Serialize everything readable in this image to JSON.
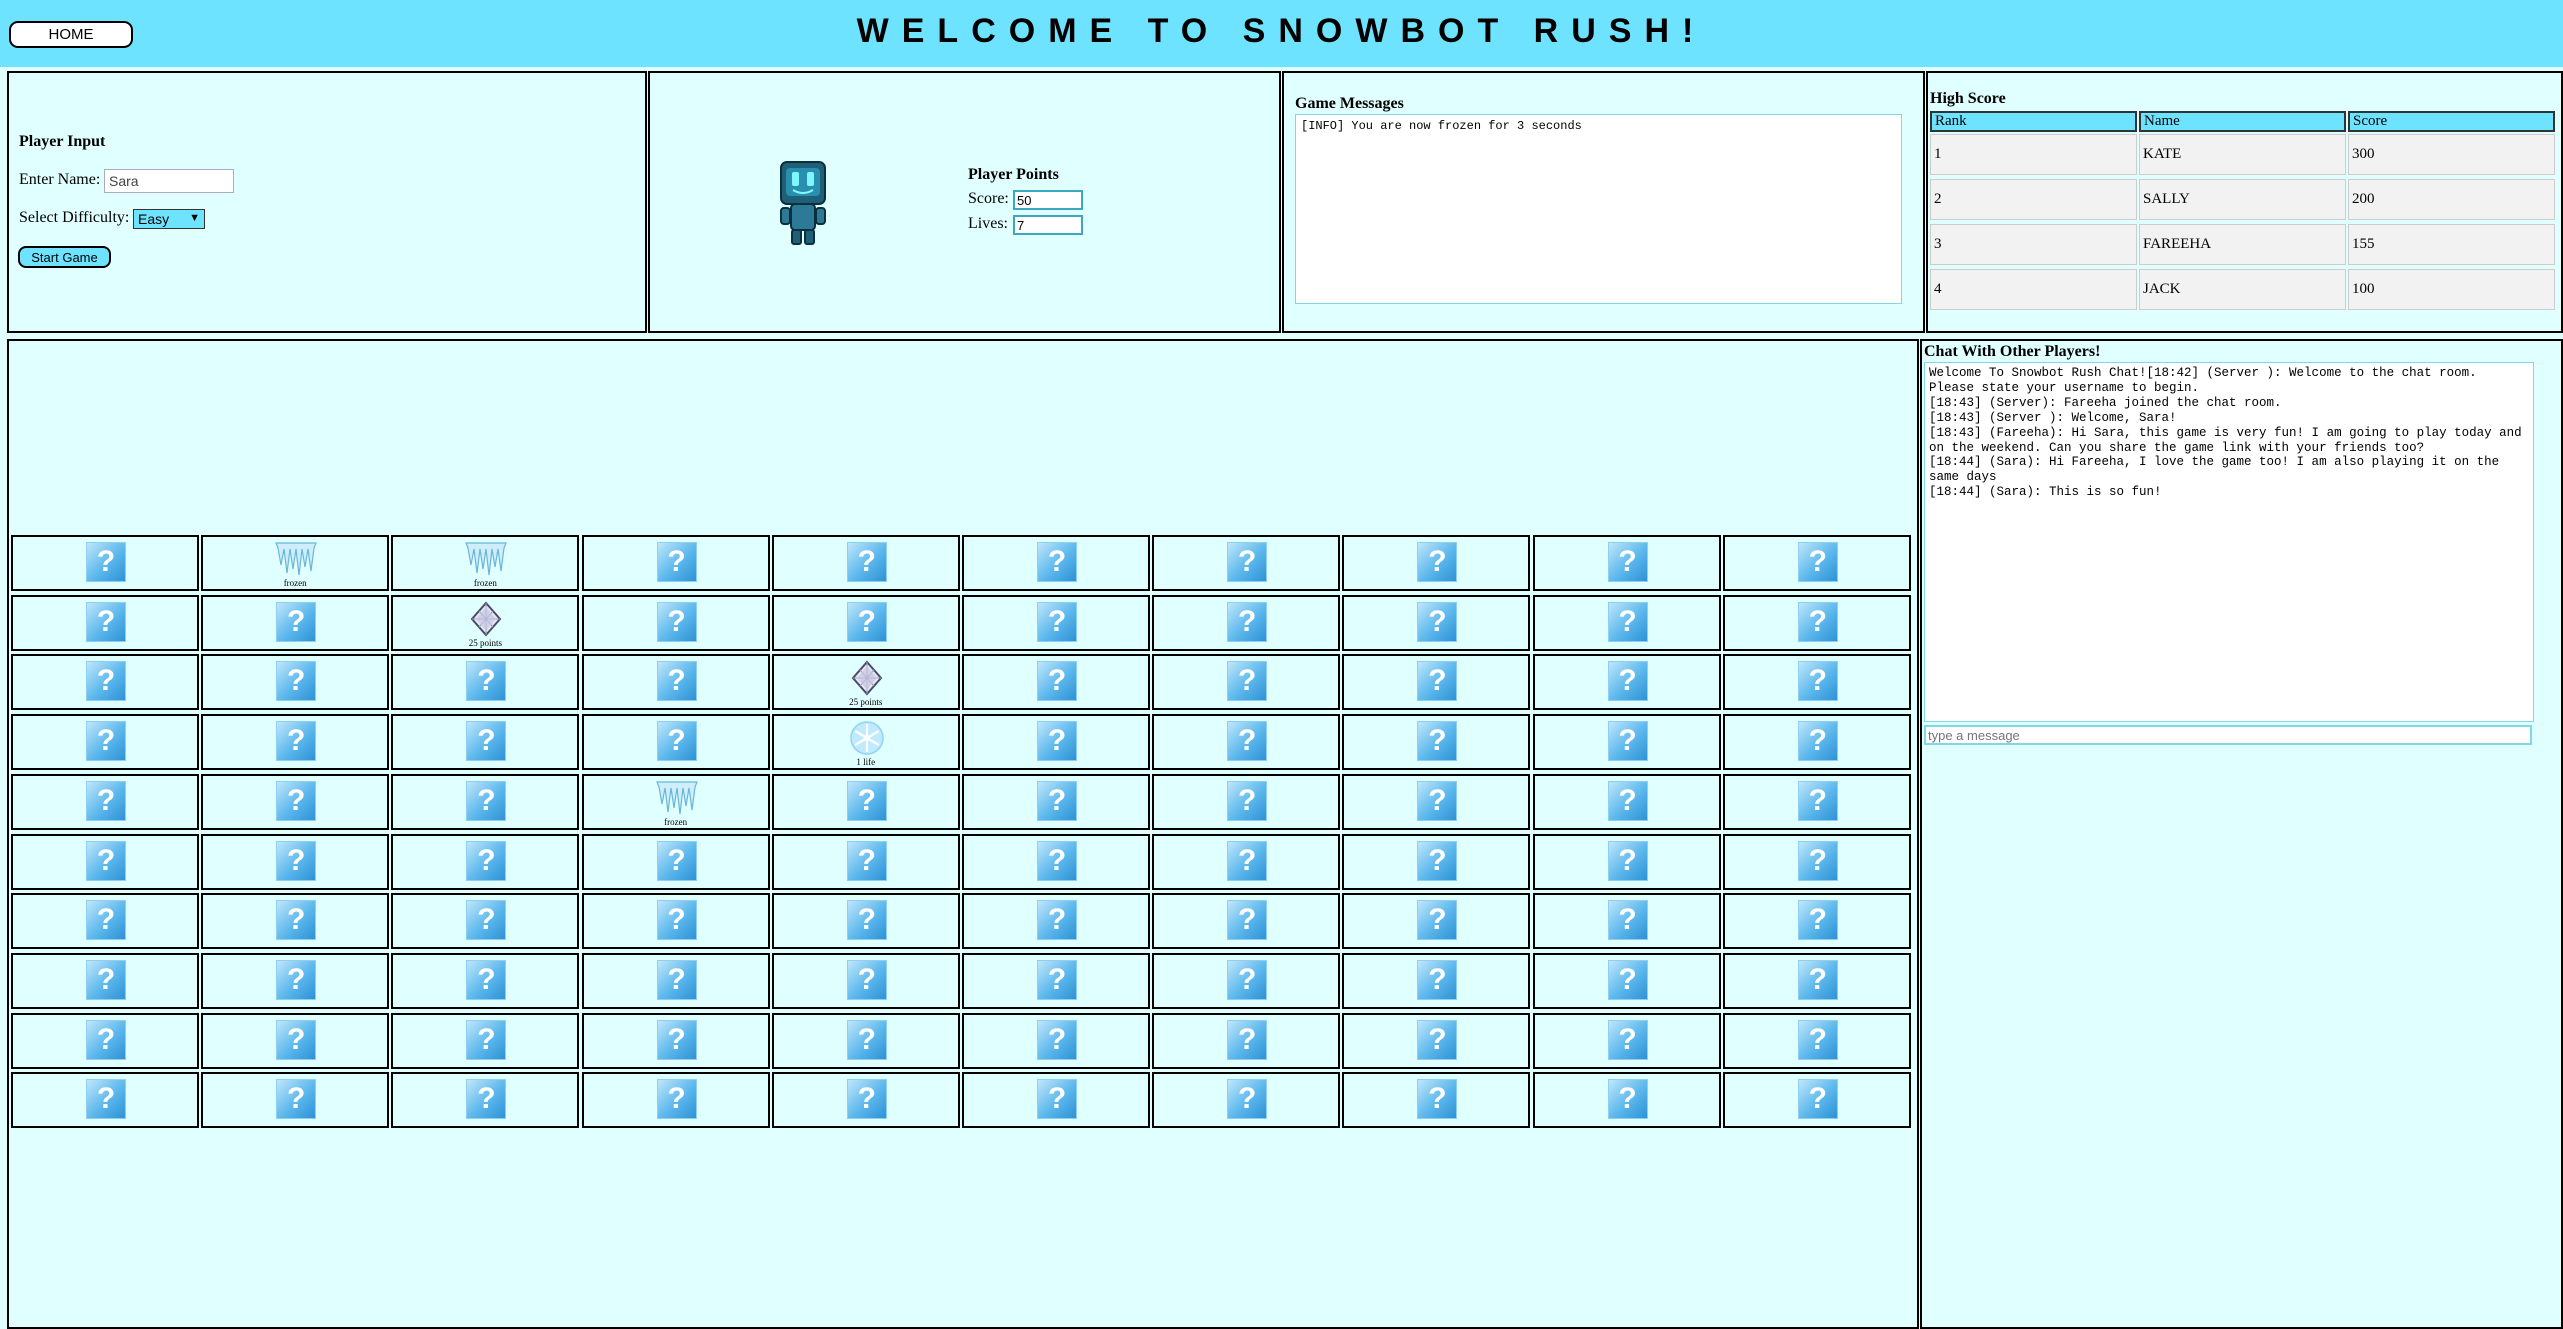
{
  "header": {
    "home_label": "HOME",
    "title": "WELCOME TO SNOWBOT RUSH!"
  },
  "player_input": {
    "title": "Player Input",
    "name_label": "Enter Name:",
    "name_value": "Sara",
    "difficulty_label": "Select Difficulty:",
    "difficulty_value": "Easy",
    "start_label": "Start Game"
  },
  "player_points": {
    "title": "Player Points",
    "score_label": "Score:",
    "score_value": "50",
    "lives_label": "Lives:",
    "lives_value": "7"
  },
  "game_messages": {
    "title": "Game Messages",
    "text": "[INFO] You are now frozen for 3 seconds"
  },
  "high_score": {
    "title": "High Score",
    "headers": [
      "Rank",
      "Name",
      "Score"
    ],
    "rows": [
      [
        "1",
        "KATE",
        "300"
      ],
      [
        "2",
        "SALLY",
        "200"
      ],
      [
        "3",
        "FAREEHA",
        "155"
      ],
      [
        "4",
        "JACK",
        "100"
      ]
    ]
  },
  "grid": {
    "rows": 10,
    "cols": 10,
    "hidden_symbol": "?",
    "revealed": [
      {
        "row": 0,
        "col": 1,
        "icon": "icicle-icon",
        "label": "frozen"
      },
      {
        "row": 0,
        "col": 2,
        "icon": "icicle-icon",
        "label": "frozen"
      },
      {
        "row": 1,
        "col": 2,
        "icon": "diamond-icon",
        "label": "25 points"
      },
      {
        "row": 2,
        "col": 4,
        "icon": "diamond-icon",
        "label": "25 points"
      },
      {
        "row": 3,
        "col": 4,
        "icon": "snowflake-icon",
        "label": "1 life"
      },
      {
        "row": 4,
        "col": 3,
        "icon": "icicle-icon",
        "label": "frozen"
      }
    ]
  },
  "chat": {
    "title": "Chat With Other Players!",
    "log": "Welcome To Snowbot Rush Chat![18:42] (Server ): Welcome to the chat room. Please state your username to begin.\n[18:43] (Server): Fareeha joined the chat room.\n[18:43] (Server ): Welcome, Sara!\n[18:43] (Fareeha): Hi Sara, this game is very fun! I am going to play today and on the weekend. Can you share the game link with your friends too?\n[18:44] (Sara): Hi Fareeha, I love the game too! I am also playing it on the same days\n[18:44] (Sara): This is so fun!",
    "placeholder": "type a message"
  },
  "colors": {
    "accent": "#6ee3ff",
    "background": "#e0ffff",
    "tile": "#5bb7ec"
  }
}
